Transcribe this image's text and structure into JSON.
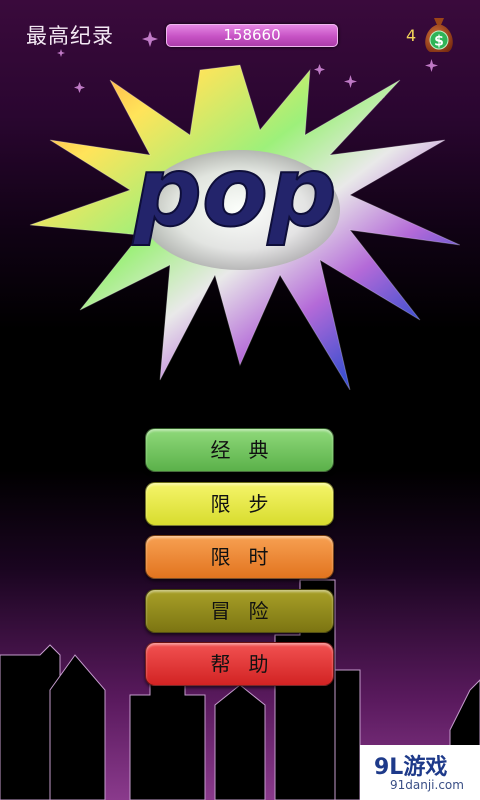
{
  "hud": {
    "best_label": "最高纪录",
    "best_score": "158660",
    "coins": "4",
    "moneybag_icon": "money-bag-icon",
    "accent": "#c652c4"
  },
  "logo": {
    "text": "pop",
    "icon": "starburst-logo"
  },
  "menu": [
    {
      "label": "经典",
      "color": "#6cc257"
    },
    {
      "label": "限步",
      "color": "#e6ea3c"
    },
    {
      "label": "限时",
      "color": "#ee8a33"
    },
    {
      "label": "冒险",
      "color": "#8e871c"
    },
    {
      "label": "帮助",
      "color": "#e13434"
    }
  ],
  "watermark": {
    "brand": "9L游戏",
    "url": "91danji.com"
  }
}
